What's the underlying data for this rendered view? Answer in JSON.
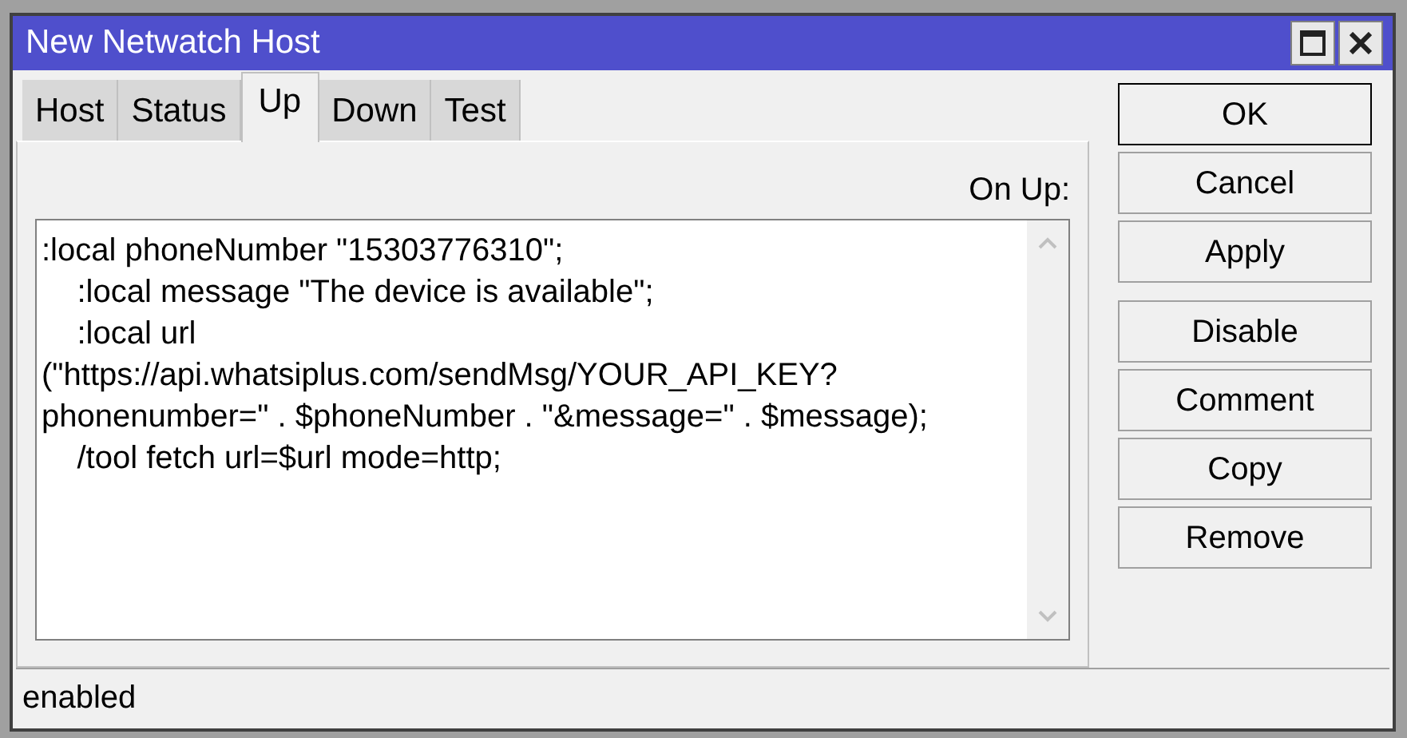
{
  "window": {
    "title": "New Netwatch Host"
  },
  "tabs": [
    {
      "label": "Host",
      "selected": false
    },
    {
      "label": "Status",
      "selected": false
    },
    {
      "label": "Up",
      "selected": true
    },
    {
      "label": "Down",
      "selected": false
    },
    {
      "label": "Test",
      "selected": false
    }
  ],
  "field": {
    "label": "On Up:",
    "lines": [
      ":local phoneNumber \"15303776310\";",
      "    :local message \"The device is available\";",
      "    :local url",
      "(\"https://api.whatsiplus.com/sendMsg/YOUR_API_KEY?",
      "phonenumber=\" . $phoneNumber . \"&message=\" . $message);",
      "    /tool fetch url=$url mode=http;"
    ]
  },
  "buttons": [
    {
      "label": "OK",
      "default": true
    },
    {
      "label": "Cancel",
      "default": false
    },
    {
      "label": "Apply",
      "default": false
    },
    {
      "label": "Disable",
      "default": false
    },
    {
      "label": "Comment",
      "default": false
    },
    {
      "label": "Copy",
      "default": false
    },
    {
      "label": "Remove",
      "default": false
    }
  ],
  "status_bar": "enabled"
}
